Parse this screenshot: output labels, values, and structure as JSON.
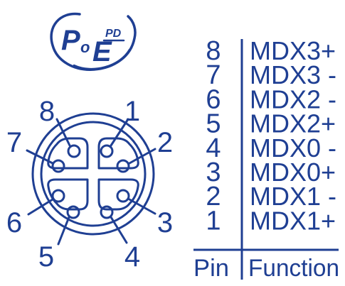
{
  "colors": {
    "ink": "#1f3f93",
    "background": "#ffffff"
  },
  "logo": {
    "text": "PoE PD",
    "icon": "poe-pd-logo"
  },
  "connector": {
    "icon": "m12-8-pin-female-connector-icon",
    "pin_labels": [
      "1",
      "2",
      "3",
      "4",
      "5",
      "6",
      "7",
      "8"
    ]
  },
  "pinout": {
    "column_headers": {
      "pin": "Pin",
      "function": "Function"
    },
    "rows": [
      {
        "pin": "8",
        "function": "MDX3+"
      },
      {
        "pin": "7",
        "function": "MDX3 -"
      },
      {
        "pin": "6",
        "function": "MDX2 -"
      },
      {
        "pin": "5",
        "function": "MDX2+"
      },
      {
        "pin": "4",
        "function": "MDX0 -"
      },
      {
        "pin": "3",
        "function": "MDX0+"
      },
      {
        "pin": "2",
        "function": "MDX1 -"
      },
      {
        "pin": "1",
        "function": "MDX1+"
      }
    ]
  }
}
